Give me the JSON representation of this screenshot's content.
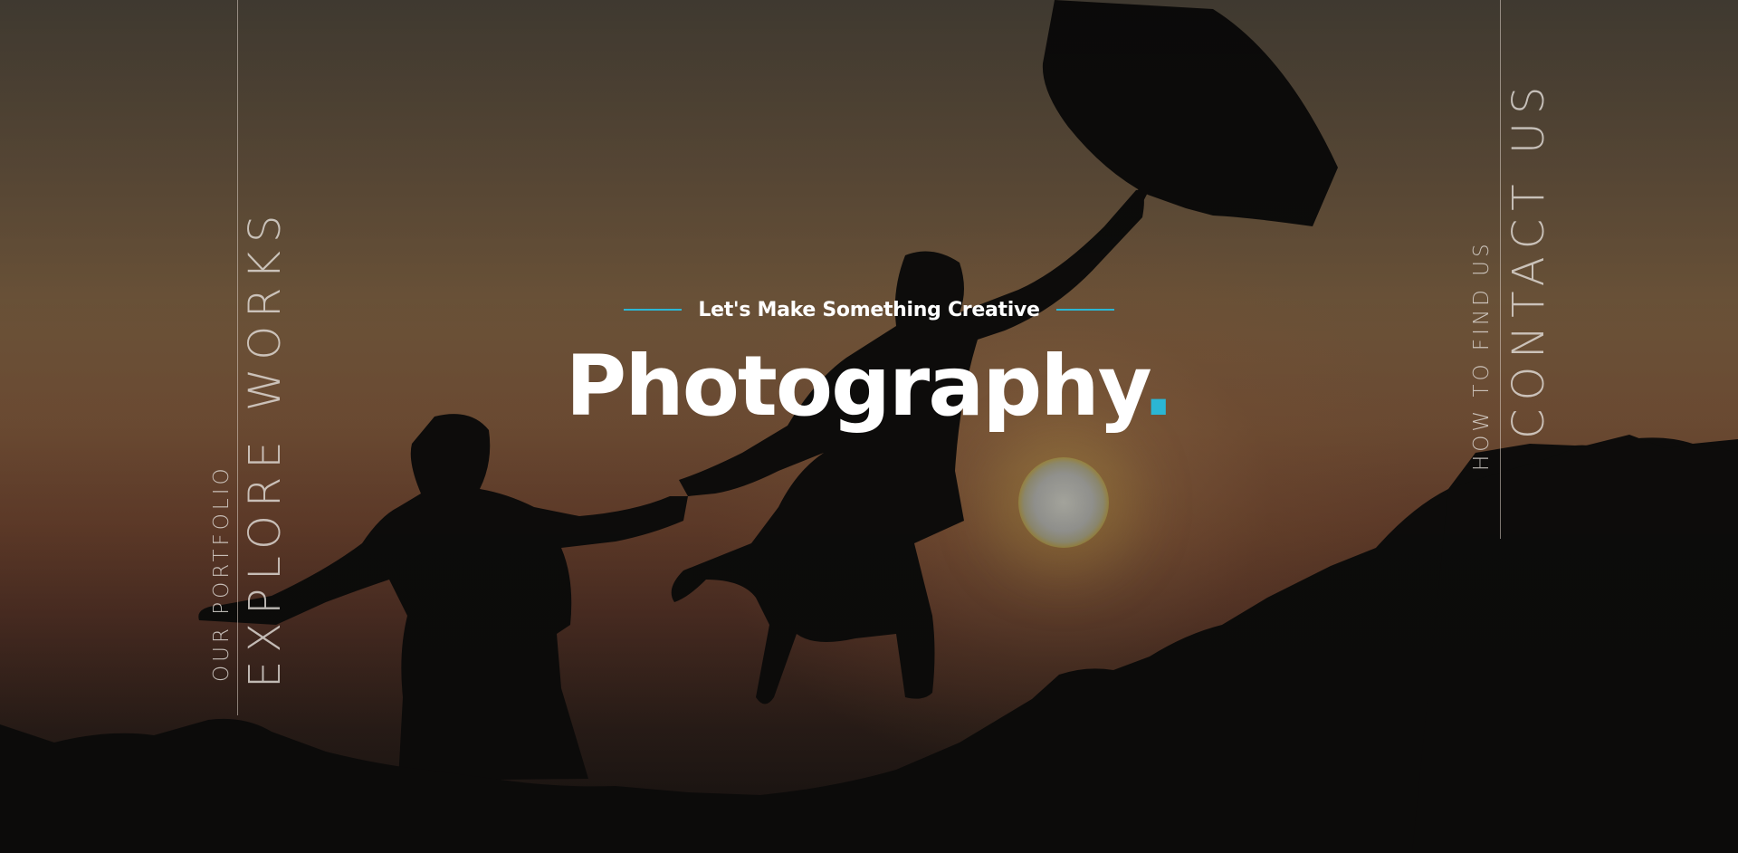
{
  "left_panel": {
    "small_label": "OUR PORTFOLIO",
    "big_label": "EXPLORE WORKS"
  },
  "right_panel": {
    "small_label": "HOW TO FIND US",
    "big_label": "CONTACT US"
  },
  "hero": {
    "tagline": "Let's Make Something Creative",
    "title": "Photography",
    "title_dot": ".",
    "accent_color": "#2bb6d4"
  }
}
